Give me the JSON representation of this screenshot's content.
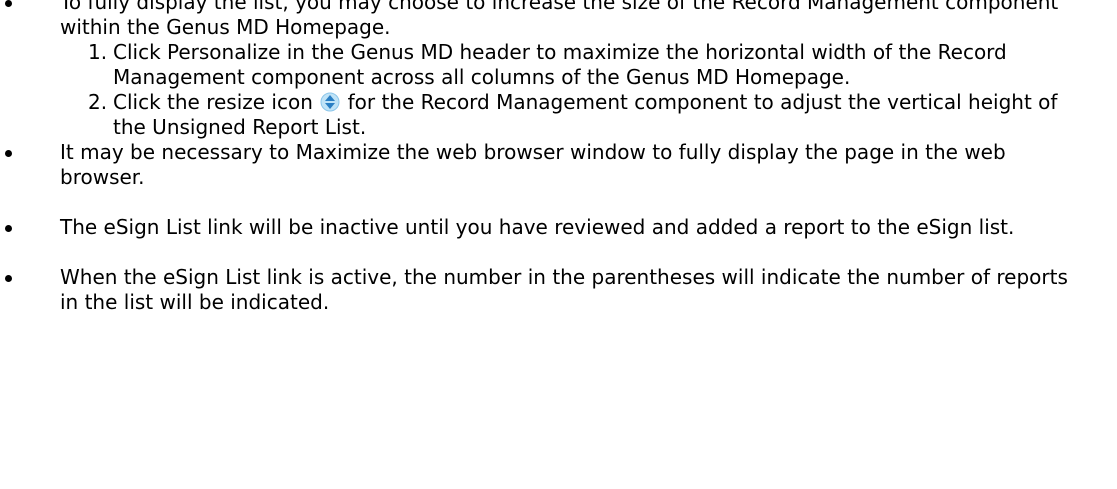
{
  "items": [
    {
      "text": "To fully display the list, you may choose to increase the size of the Record Management component within the Genus MD Homepage.",
      "steps": [
        {
          "num": "1.",
          "text": "Click Personalize in the Genus MD header to maximize the horizontal width of the Record Management component across all columns of the Genus MD Homepage."
        },
        {
          "num": "2.",
          "before_icon": "Click the resize icon",
          "icon": "resize-up-down-icon",
          "after_icon": "for the Record Management component to adjust the vertical height of the Unsigned Report List."
        }
      ]
    },
    {
      "text": "It may be necessary to Maximize the web browser window to fully display the page in the web browser."
    },
    {
      "text": "The eSign List link will be inactive until you have reviewed and added a report to the eSign list."
    },
    {
      "text": "When the eSign List link is active, the number in the parentheses will indicate the number of reports in the list will be indicated."
    }
  ],
  "colors": {
    "text": "#000000",
    "icon_light": "#bfe3f7",
    "icon_dark": "#2a7fc4"
  }
}
